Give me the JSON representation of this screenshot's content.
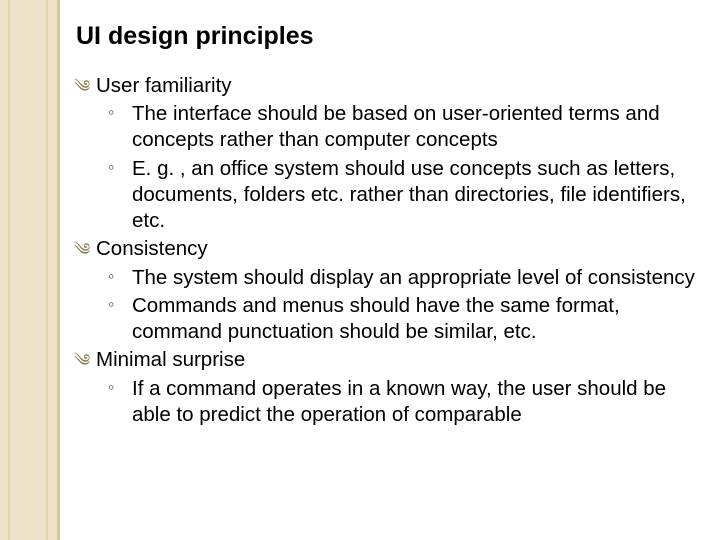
{
  "title": "UI design principles",
  "items": [
    {
      "label": "User familiarity",
      "subs": [
        "The interface should be based on user-oriented terms and concepts rather than computer concepts",
        "E. g. , an office system should use concepts such as letters, documents, folders etc. rather than directories, file identifiers, etc."
      ]
    },
    {
      "label": "Consistency",
      "subs": [
        "The system should display an appropriate level of consistency",
        "Commands and menus should have the same format, command punctuation should be similar, etc."
      ]
    },
    {
      "label": "Minimal surprise",
      "subs": [
        "If a command operates in a known way, the user should be able to predict the operation of comparable"
      ]
    }
  ]
}
